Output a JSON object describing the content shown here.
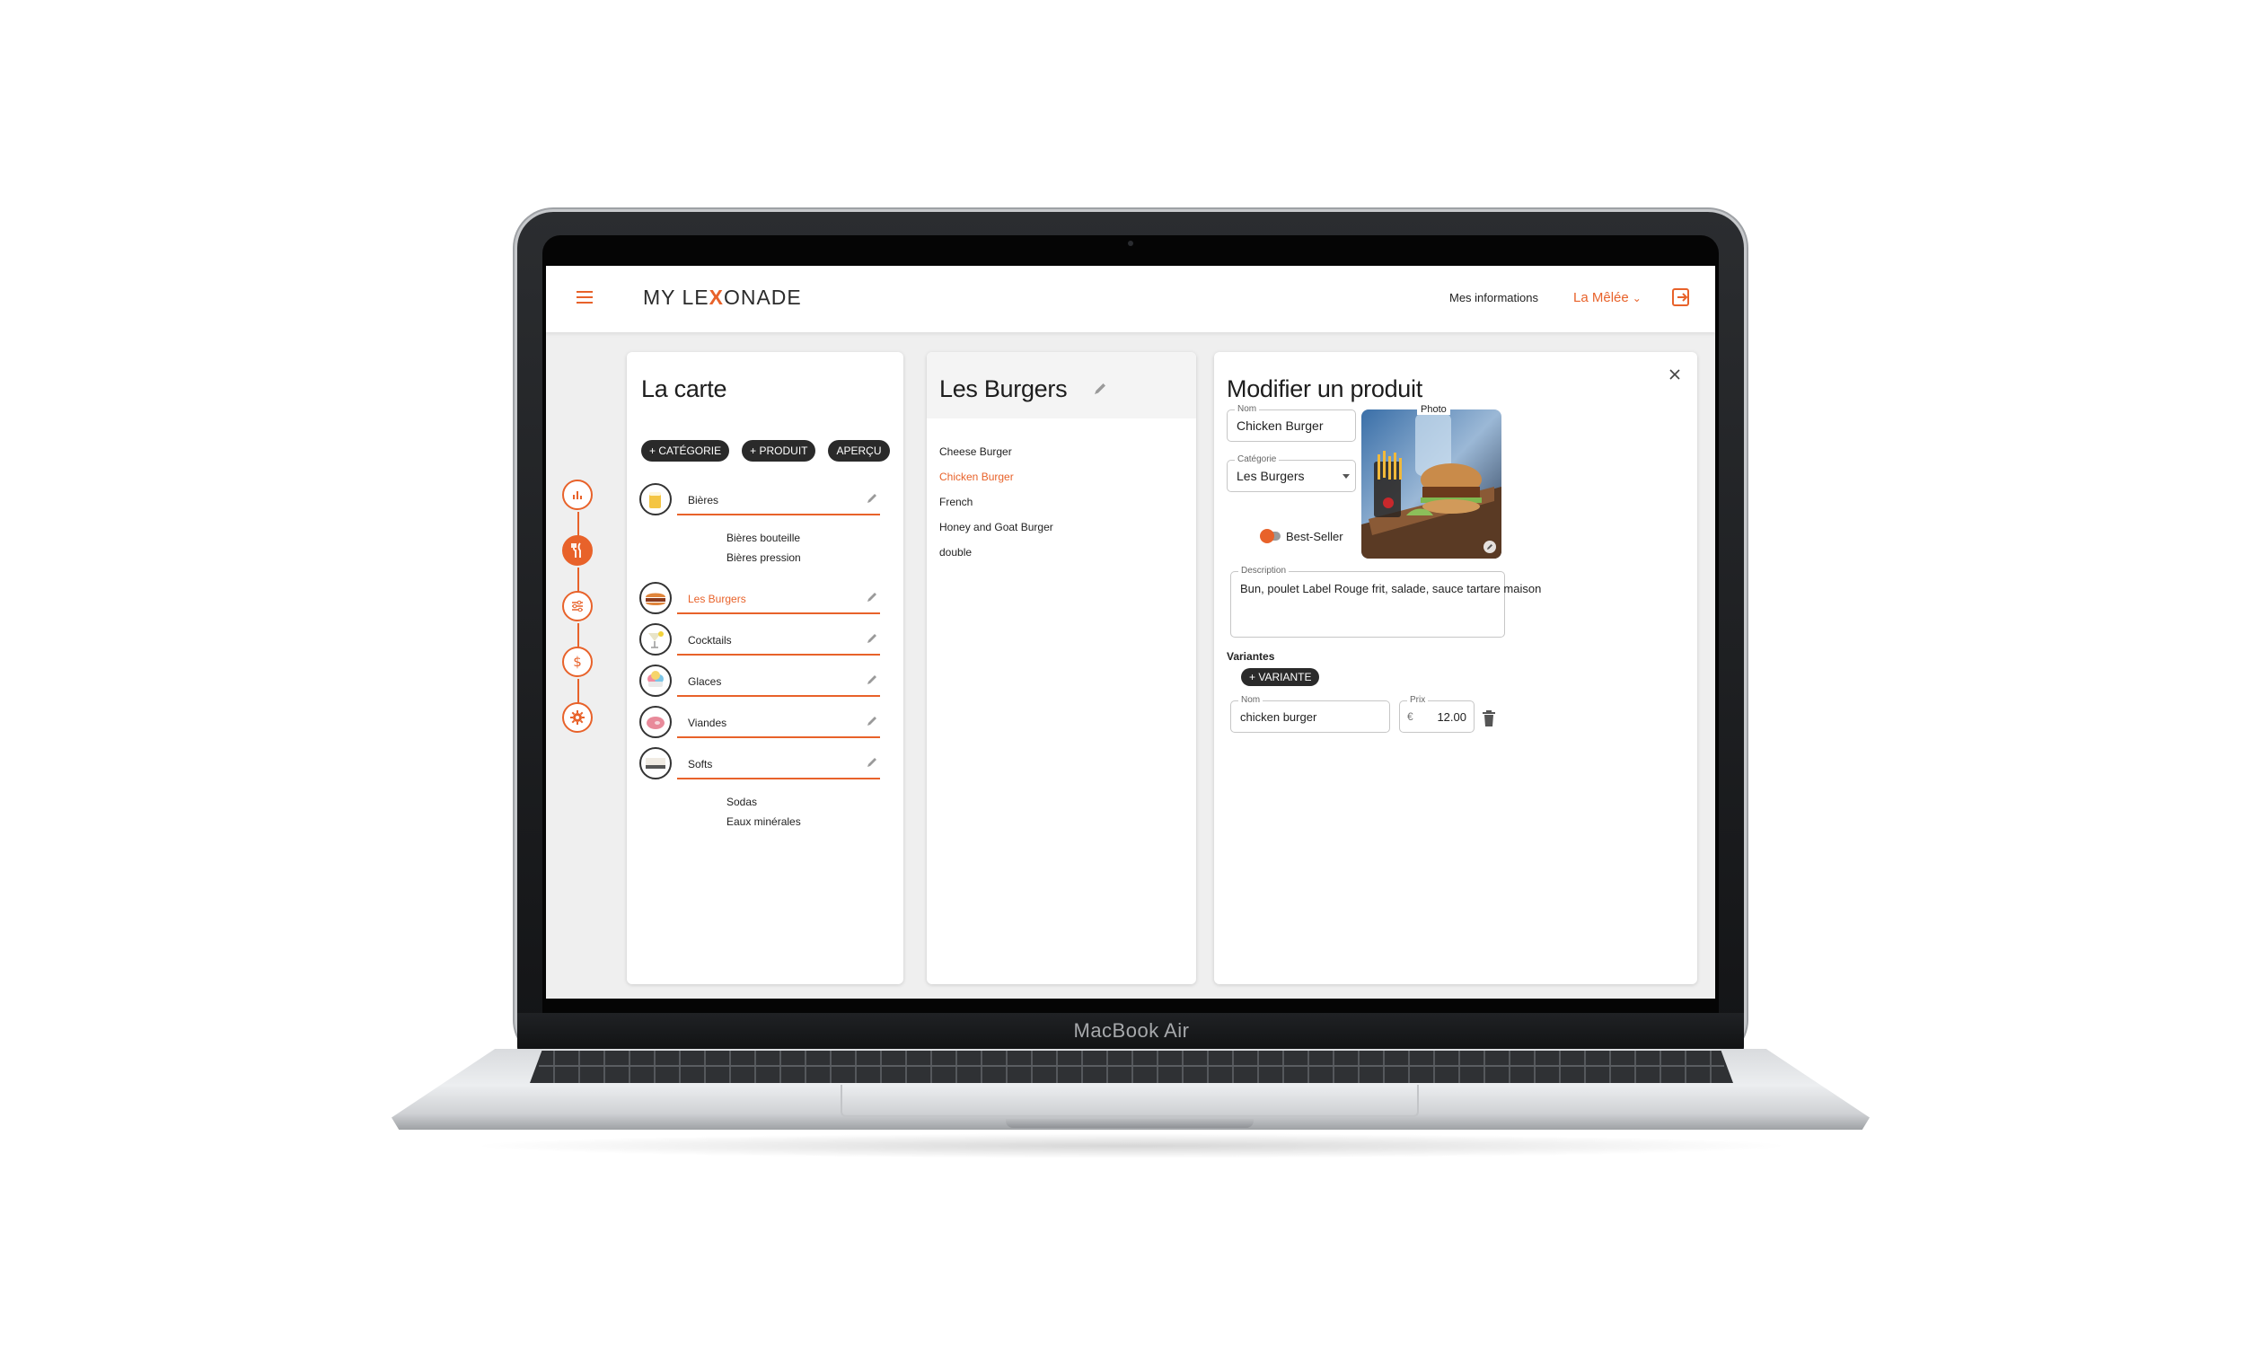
{
  "device": {
    "brand_label": "MacBook Air"
  },
  "colors": {
    "accent": "#e8622a",
    "chip_bg": "#2a2a2a",
    "panel_header_bg": "#f4f4f4"
  },
  "topbar": {
    "logo_prefix": "MY LE",
    "logo_mark": "X",
    "logo_suffix": "ONADE",
    "my_info_label": "Mes informations",
    "venue_label": "La Mêlée",
    "venue_chevron": "⌄"
  },
  "rail": {
    "icons": [
      "bar-chart-icon",
      "cutlery-icon",
      "sliders-icon",
      "dollar-icon",
      "gear-icon"
    ],
    "active_index": 1
  },
  "menu_panel": {
    "title": "La carte",
    "chips": [
      "+ CATÉGORIE",
      "+ PRODUIT",
      "APERÇU"
    ],
    "categories": [
      {
        "label": "Bières",
        "subcategories": [
          "Bières bouteille",
          "Bières pression"
        ]
      },
      {
        "label": "Les Burgers",
        "active": true
      },
      {
        "label": "Cocktails"
      },
      {
        "label": "Glaces"
      },
      {
        "label": "Viandes"
      },
      {
        "label": "Softs",
        "subcategories": [
          "Sodas",
          "Eaux minérales"
        ]
      }
    ]
  },
  "products_panel": {
    "title": "Les Burgers",
    "items": [
      "Cheese Burger",
      "Chicken Burger",
      "French",
      "Honey and Goat Burger",
      "double"
    ],
    "active_index": 1
  },
  "edit_panel": {
    "title": "Modifier un produit",
    "name_label": "Nom",
    "name_value": "Chicken Burger",
    "category_label": "Catégorie",
    "category_value": "Les Burgers",
    "photo_label": "Photo",
    "bestseller_label": "Best-Seller",
    "description_label": "Description",
    "description_value": "Bun, poulet Label Rouge frit, salade, sauce tartare maison",
    "variants_label": "Variantes",
    "add_variant_label": "+ VARIANTE",
    "variant": {
      "name_label": "Nom",
      "name_value": "chicken burger",
      "price_label": "Prix",
      "currency": "€",
      "price_value": "12.00"
    }
  }
}
